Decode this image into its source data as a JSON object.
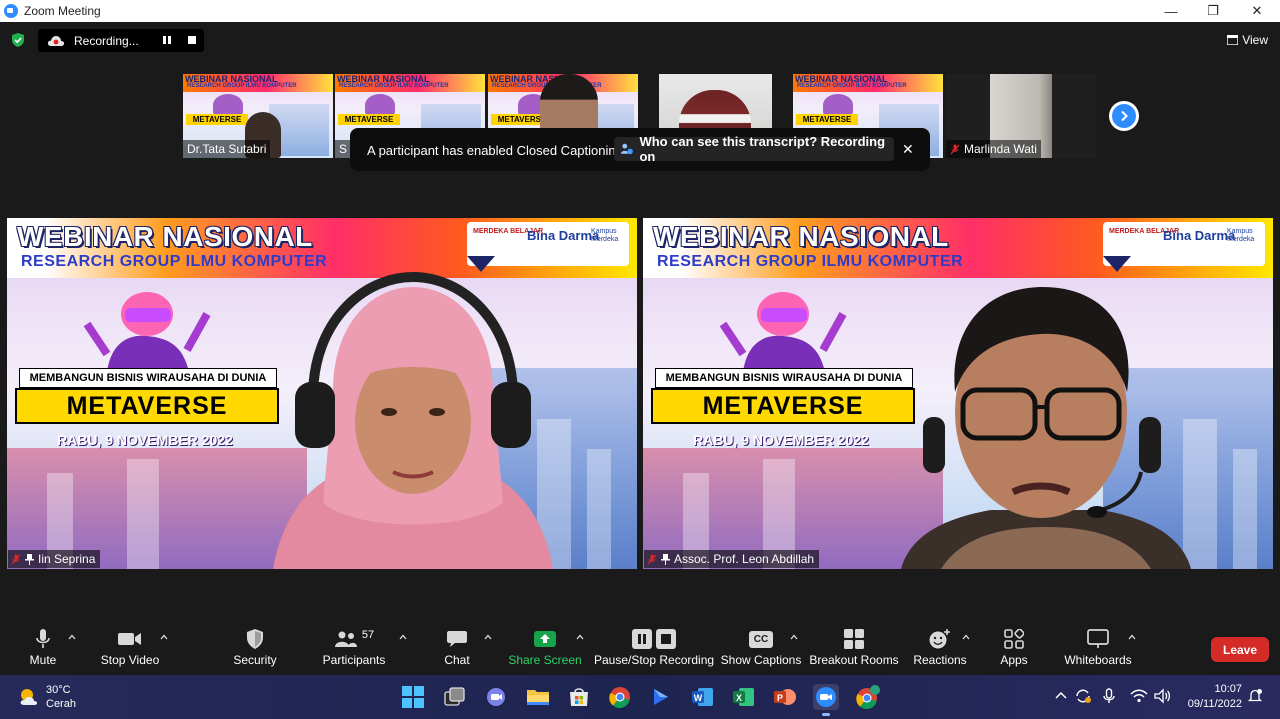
{
  "window": {
    "title": "Zoom Meeting",
    "minimize": "—",
    "maximize": "❐",
    "close": "✕"
  },
  "top_bar": {
    "recording_status": "Recording...",
    "view_label": "View"
  },
  "thumbnails": [
    {
      "name": "Dr.Tata Sutabri",
      "kind": "slide"
    },
    {
      "name": "S",
      "kind": "slide"
    },
    {
      "name": "",
      "kind": "slide"
    },
    {
      "name": "",
      "kind": "camera"
    },
    {
      "name": "",
      "kind": "slide"
    },
    {
      "name": "Marlinda Wati",
      "kind": "camera"
    }
  ],
  "thumb_slide": {
    "title": "WEBINAR NASIONAL",
    "subtitle": "RESEARCH GROUP ILMU KOMPUTER",
    "badge": "METAVERSE"
  },
  "caption_notice": {
    "message": "A participant has enabled Closed Captioning",
    "prompt": "Who can see this transcript? Recording on",
    "close": "✕"
  },
  "tiles": [
    {
      "name": "Iin Seprina"
    },
    {
      "name": "Assoc. Prof. Leon Abdillah"
    }
  ],
  "slide": {
    "title": "WEBINAR NASIONAL",
    "subtitle": "RESEARCH GROUP ILMU KOMPUTER",
    "logo_left": "MERDEKA BELAJAR",
    "logo_mid": "Bina Darma",
    "logo_right": "Kampus Merdeka",
    "tagline": "MEMBANGUN BISNIS WIRAUSAHA DI DUNIA",
    "headline": "METAVERSE",
    "date": "RABU, 9 NOVEMBER 2022"
  },
  "toolbar": {
    "mute": "Mute",
    "stop_video": "Stop Video",
    "security": "Security",
    "participants": "Participants",
    "participant_count": "57",
    "chat": "Chat",
    "share_screen": "Share Screen",
    "recording": "Pause/Stop Recording",
    "captions": "Show Captions",
    "breakout": "Breakout Rooms",
    "reactions": "Reactions",
    "apps": "Apps",
    "whiteboards": "Whiteboards",
    "leave": "Leave",
    "cc_badge": "CC"
  },
  "taskbar": {
    "temperature": "30°C",
    "condition": "Cerah",
    "time": "10:07",
    "date": "09/11/2022"
  },
  "colors": {
    "accent": "#2d8cff",
    "leave": "#d42b27",
    "share": "#17a34a"
  }
}
